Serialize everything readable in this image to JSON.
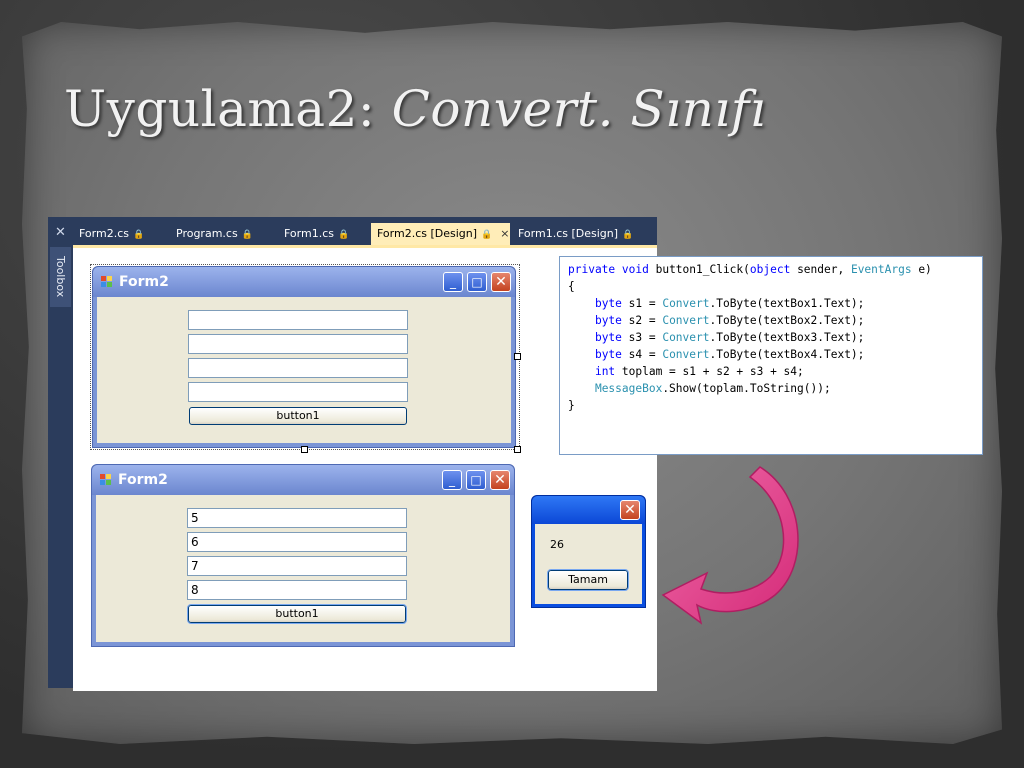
{
  "slide": {
    "title_plain": "Uygulama2: ",
    "title_italic": "Convert. Sınıfı"
  },
  "ide": {
    "toolbox_label": "Toolbox",
    "tabs": [
      {
        "label": "Form2.cs"
      },
      {
        "label": "Program.cs"
      },
      {
        "label": "Form1.cs"
      },
      {
        "label": "Form2.cs [Design]"
      },
      {
        "label": "Form1.cs [Design]"
      }
    ],
    "active_tab": "Form2.cs [Design]",
    "close_glyph": "×",
    "lock_glyph": "🔒"
  },
  "design_form": {
    "title": "Form2",
    "textboxes": [
      "",
      "",
      "",
      ""
    ],
    "button_label": "button1"
  },
  "runtime_form": {
    "title": "Form2",
    "textboxes": [
      "5",
      "6",
      "7",
      "8"
    ],
    "button_label": "button1"
  },
  "window_buttons": {
    "minimize": "_",
    "maximize": "□",
    "close": "✕"
  },
  "code": {
    "lines": [
      "private void button1_Click(object sender, EventArgs e)",
      "{",
      "    byte s1 = Convert.ToByte(textBox1.Text);",
      "    byte s2 = Convert.ToByte(textBox2.Text);",
      "    byte s3 = Convert.ToByte(textBox3.Text);",
      "    byte s4 = Convert.ToByte(textBox4.Text);",
      "    int toplam = s1 + s2 + s3 + s4;",
      "    MessageBox.Show(toplam.ToString());",
      "}"
    ]
  },
  "message_box": {
    "text": "26",
    "button_label": "Tamam",
    "close": "✕"
  },
  "colors": {
    "arrow": "#e8418c",
    "keyword": "#0000ff",
    "type": "#2b91af"
  }
}
